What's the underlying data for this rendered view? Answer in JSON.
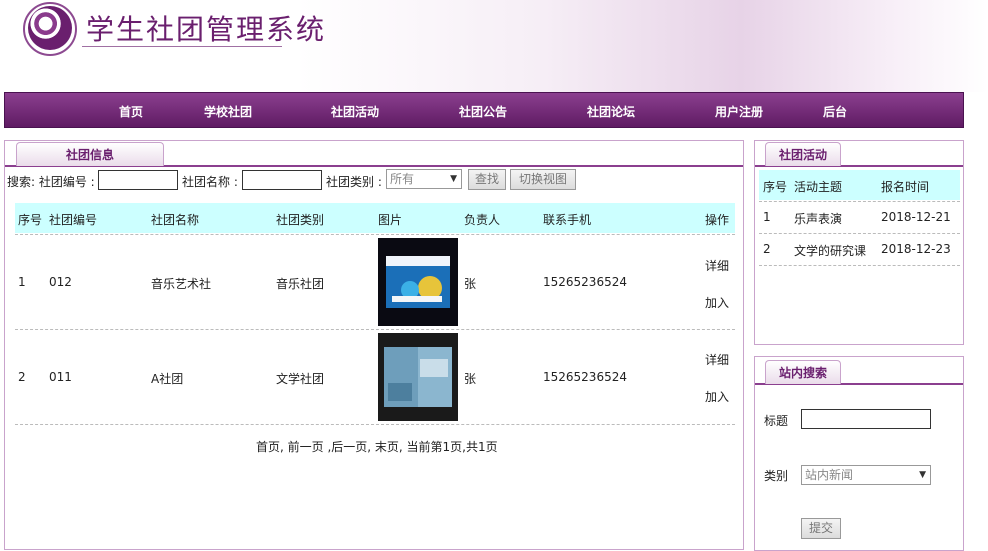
{
  "header": {
    "title": "学生社团管理系统"
  },
  "nav": [
    "首页",
    "学校社团",
    "社团活动",
    "社团公告",
    "社团论坛",
    "用户注册",
    "后台"
  ],
  "main": {
    "tab": "社团信息",
    "search": {
      "prefix": "搜索: 社团编号 :",
      "name_label": "社团名称 :",
      "type_label": "社团类别 :",
      "type_value": "所有",
      "search_button": "查找",
      "switch_button": "切换视图"
    },
    "columns": [
      "序号",
      "社团编号",
      "社团名称",
      "社团类别",
      "图片",
      "负责人",
      "联系手机",
      "操作"
    ],
    "rows": [
      {
        "no": "1",
        "code": "012",
        "name": "音乐艺术社",
        "type": "音乐社团",
        "leader": "张",
        "phone": "15265236524",
        "detail": "详细",
        "join": "加入"
      },
      {
        "no": "2",
        "code": "011",
        "name": "A社团",
        "type": "文学社团",
        "leader": "张",
        "phone": "15265236524",
        "detail": "详细",
        "join": "加入"
      }
    ],
    "pagination": "首页, 前一页 ,后一页, 末页, 当前第1页,共1页"
  },
  "activity": {
    "tab": "社团活动",
    "columns": [
      "序号",
      "活动主题",
      "报名时间"
    ],
    "rows": [
      {
        "no": "1",
        "topic": "乐声表演",
        "date": "2018-12-21"
      },
      {
        "no": "2",
        "topic": "文学的研究课",
        "date": "2018-12-23"
      }
    ]
  },
  "site_search": {
    "tab": "站内搜索",
    "title_label": "标题",
    "type_label": "类别",
    "type_value": "站内新闻",
    "submit": "提交"
  }
}
